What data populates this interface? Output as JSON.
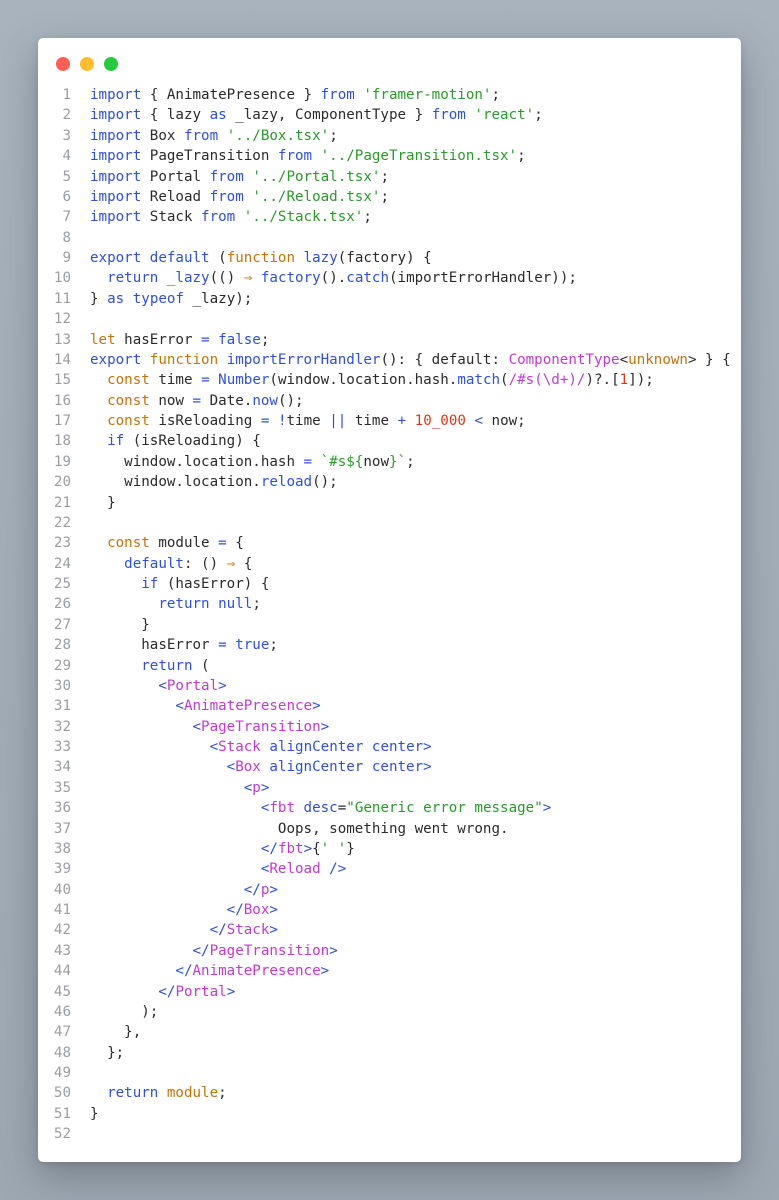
{
  "window": {
    "controls": [
      "close",
      "minimize",
      "maximize"
    ]
  },
  "code": {
    "lines": [
      [
        {
          "t": "import",
          "c": "kw"
        },
        {
          "t": " { AnimatePresence } ",
          "c": ""
        },
        {
          "t": "from",
          "c": "kw"
        },
        {
          "t": " ",
          "c": ""
        },
        {
          "t": "'framer-motion'",
          "c": "str"
        },
        {
          "t": ";",
          "c": ""
        }
      ],
      [
        {
          "t": "import",
          "c": "kw"
        },
        {
          "t": " { lazy ",
          "c": ""
        },
        {
          "t": "as",
          "c": "kw"
        },
        {
          "t": " _lazy, ComponentType } ",
          "c": ""
        },
        {
          "t": "from",
          "c": "kw"
        },
        {
          "t": " ",
          "c": ""
        },
        {
          "t": "'react'",
          "c": "str"
        },
        {
          "t": ";",
          "c": ""
        }
      ],
      [
        {
          "t": "import",
          "c": "kw"
        },
        {
          "t": " Box ",
          "c": ""
        },
        {
          "t": "from",
          "c": "kw"
        },
        {
          "t": " ",
          "c": ""
        },
        {
          "t": "'../Box.tsx'",
          "c": "str"
        },
        {
          "t": ";",
          "c": ""
        }
      ],
      [
        {
          "t": "import",
          "c": "kw"
        },
        {
          "t": " PageTransition ",
          "c": ""
        },
        {
          "t": "from",
          "c": "kw"
        },
        {
          "t": " ",
          "c": ""
        },
        {
          "t": "'../PageTransition.tsx'",
          "c": "str"
        },
        {
          "t": ";",
          "c": ""
        }
      ],
      [
        {
          "t": "import",
          "c": "kw"
        },
        {
          "t": " Portal ",
          "c": ""
        },
        {
          "t": "from",
          "c": "kw"
        },
        {
          "t": " ",
          "c": ""
        },
        {
          "t": "'../Portal.tsx'",
          "c": "str"
        },
        {
          "t": ";",
          "c": ""
        }
      ],
      [
        {
          "t": "import",
          "c": "kw"
        },
        {
          "t": " Reload ",
          "c": ""
        },
        {
          "t": "from",
          "c": "kw"
        },
        {
          "t": " ",
          "c": ""
        },
        {
          "t": "'../Reload.tsx'",
          "c": "str"
        },
        {
          "t": ";",
          "c": ""
        }
      ],
      [
        {
          "t": "import",
          "c": "kw"
        },
        {
          "t": " Stack ",
          "c": ""
        },
        {
          "t": "from",
          "c": "kw"
        },
        {
          "t": " ",
          "c": ""
        },
        {
          "t": "'../Stack.tsx'",
          "c": "str"
        },
        {
          "t": ";",
          "c": ""
        }
      ],
      [],
      [
        {
          "t": "export",
          "c": "kw"
        },
        {
          "t": " ",
          "c": ""
        },
        {
          "t": "default",
          "c": "kw"
        },
        {
          "t": " (",
          "c": ""
        },
        {
          "t": "function",
          "c": "fn"
        },
        {
          "t": " ",
          "c": ""
        },
        {
          "t": "lazy",
          "c": "kw"
        },
        {
          "t": "(factory) {",
          "c": ""
        }
      ],
      [
        {
          "t": "  ",
          "c": ""
        },
        {
          "t": "return",
          "c": "kw"
        },
        {
          "t": " ",
          "c": ""
        },
        {
          "t": "_lazy",
          "c": "kw"
        },
        {
          "t": "(() ",
          "c": ""
        },
        {
          "t": "⇒",
          "c": "fn"
        },
        {
          "t": " ",
          "c": ""
        },
        {
          "t": "factory",
          "c": "kw"
        },
        {
          "t": "().",
          "c": ""
        },
        {
          "t": "catch",
          "c": "kw"
        },
        {
          "t": "(importErrorHandler));",
          "c": ""
        }
      ],
      [
        {
          "t": "} ",
          "c": ""
        },
        {
          "t": "as",
          "c": "kw"
        },
        {
          "t": " ",
          "c": ""
        },
        {
          "t": "typeof",
          "c": "kw"
        },
        {
          "t": " _lazy);",
          "c": ""
        }
      ],
      [],
      [
        {
          "t": "let",
          "c": "fn"
        },
        {
          "t": " hasError ",
          "c": ""
        },
        {
          "t": "=",
          "c": "op"
        },
        {
          "t": " ",
          "c": ""
        },
        {
          "t": "false",
          "c": "kw"
        },
        {
          "t": ";",
          "c": ""
        }
      ],
      [
        {
          "t": "export",
          "c": "kw"
        },
        {
          "t": " ",
          "c": ""
        },
        {
          "t": "function",
          "c": "fn"
        },
        {
          "t": " ",
          "c": ""
        },
        {
          "t": "importErrorHandler",
          "c": "kw"
        },
        {
          "t": "(): { default: ",
          "c": ""
        },
        {
          "t": "ComponentType",
          "c": "ty"
        },
        {
          "t": "<",
          "c": ""
        },
        {
          "t": "unknown",
          "c": "fn"
        },
        {
          "t": "> } {",
          "c": ""
        }
      ],
      [
        {
          "t": "  ",
          "c": ""
        },
        {
          "t": "const",
          "c": "fn"
        },
        {
          "t": " time ",
          "c": ""
        },
        {
          "t": "=",
          "c": "op"
        },
        {
          "t": " ",
          "c": ""
        },
        {
          "t": "Number",
          "c": "kw"
        },
        {
          "t": "(window.location.hash.",
          "c": ""
        },
        {
          "t": "match",
          "c": "kw"
        },
        {
          "t": "(",
          "c": ""
        },
        {
          "t": "/#s(\\d+)/",
          "c": "tag"
        },
        {
          "t": ")?.[",
          "c": ""
        },
        {
          "t": "1",
          "c": "num"
        },
        {
          "t": "]);",
          "c": ""
        }
      ],
      [
        {
          "t": "  ",
          "c": ""
        },
        {
          "t": "const",
          "c": "fn"
        },
        {
          "t": " now ",
          "c": ""
        },
        {
          "t": "=",
          "c": "op"
        },
        {
          "t": " Date.",
          "c": ""
        },
        {
          "t": "now",
          "c": "kw"
        },
        {
          "t": "();",
          "c": ""
        }
      ],
      [
        {
          "t": "  ",
          "c": ""
        },
        {
          "t": "const",
          "c": "fn"
        },
        {
          "t": " isReloading ",
          "c": ""
        },
        {
          "t": "=",
          "c": "op"
        },
        {
          "t": " ",
          "c": ""
        },
        {
          "t": "!",
          "c": "op"
        },
        {
          "t": "time ",
          "c": ""
        },
        {
          "t": "||",
          "c": "op"
        },
        {
          "t": " time ",
          "c": ""
        },
        {
          "t": "+",
          "c": "op"
        },
        {
          "t": " ",
          "c": ""
        },
        {
          "t": "10_000",
          "c": "num"
        },
        {
          "t": " ",
          "c": ""
        },
        {
          "t": "<",
          "c": "op"
        },
        {
          "t": " now;",
          "c": ""
        }
      ],
      [
        {
          "t": "  ",
          "c": ""
        },
        {
          "t": "if",
          "c": "kw"
        },
        {
          "t": " (isReloading) {",
          "c": ""
        }
      ],
      [
        {
          "t": "    window.location.hash ",
          "c": ""
        },
        {
          "t": "=",
          "c": "op"
        },
        {
          "t": " ",
          "c": ""
        },
        {
          "t": "`#s${",
          "c": "str"
        },
        {
          "t": "now",
          "c": ""
        },
        {
          "t": "}`",
          "c": "str"
        },
        {
          "t": ";",
          "c": ""
        }
      ],
      [
        {
          "t": "    window.location.",
          "c": ""
        },
        {
          "t": "reload",
          "c": "kw"
        },
        {
          "t": "();",
          "c": ""
        }
      ],
      [
        {
          "t": "  }",
          "c": ""
        }
      ],
      [],
      [
        {
          "t": "  ",
          "c": ""
        },
        {
          "t": "const",
          "c": "fn"
        },
        {
          "t": " module ",
          "c": ""
        },
        {
          "t": "=",
          "c": "op"
        },
        {
          "t": " {",
          "c": ""
        }
      ],
      [
        {
          "t": "    ",
          "c": ""
        },
        {
          "t": "default",
          "c": "kw"
        },
        {
          "t": ": () ",
          "c": ""
        },
        {
          "t": "⇒",
          "c": "fn"
        },
        {
          "t": " {",
          "c": ""
        }
      ],
      [
        {
          "t": "      ",
          "c": ""
        },
        {
          "t": "if",
          "c": "kw"
        },
        {
          "t": " (hasError) {",
          "c": ""
        }
      ],
      [
        {
          "t": "        ",
          "c": ""
        },
        {
          "t": "return",
          "c": "kw"
        },
        {
          "t": " ",
          "c": ""
        },
        {
          "t": "null",
          "c": "kw"
        },
        {
          "t": ";",
          "c": ""
        }
      ],
      [
        {
          "t": "      }",
          "c": ""
        }
      ],
      [
        {
          "t": "      hasError ",
          "c": ""
        },
        {
          "t": "=",
          "c": "op"
        },
        {
          "t": " ",
          "c": ""
        },
        {
          "t": "true",
          "c": "kw"
        },
        {
          "t": ";",
          "c": ""
        }
      ],
      [
        {
          "t": "      ",
          "c": ""
        },
        {
          "t": "return",
          "c": "kw"
        },
        {
          "t": " (",
          "c": ""
        }
      ],
      [
        {
          "t": "        ",
          "c": ""
        },
        {
          "t": "<",
          "c": "attr"
        },
        {
          "t": "Portal",
          "c": "tag"
        },
        {
          "t": ">",
          "c": "attr"
        }
      ],
      [
        {
          "t": "          ",
          "c": ""
        },
        {
          "t": "<",
          "c": "attr"
        },
        {
          "t": "AnimatePresence",
          "c": "tag"
        },
        {
          "t": ">",
          "c": "attr"
        }
      ],
      [
        {
          "t": "            ",
          "c": ""
        },
        {
          "t": "<",
          "c": "attr"
        },
        {
          "t": "PageTransition",
          "c": "tag"
        },
        {
          "t": ">",
          "c": "attr"
        }
      ],
      [
        {
          "t": "              ",
          "c": ""
        },
        {
          "t": "<",
          "c": "attr"
        },
        {
          "t": "Stack",
          "c": "tag"
        },
        {
          "t": " alignCenter center",
          "c": "attr"
        },
        {
          "t": ">",
          "c": "attr"
        }
      ],
      [
        {
          "t": "                ",
          "c": ""
        },
        {
          "t": "<",
          "c": "attr"
        },
        {
          "t": "Box",
          "c": "tag"
        },
        {
          "t": " alignCenter center",
          "c": "attr"
        },
        {
          "t": ">",
          "c": "attr"
        }
      ],
      [
        {
          "t": "                  ",
          "c": ""
        },
        {
          "t": "<",
          "c": "attr"
        },
        {
          "t": "p",
          "c": "tag"
        },
        {
          "t": ">",
          "c": "attr"
        }
      ],
      [
        {
          "t": "                    ",
          "c": ""
        },
        {
          "t": "<",
          "c": "attr"
        },
        {
          "t": "fbt",
          "c": "tag"
        },
        {
          "t": " desc",
          "c": "attr"
        },
        {
          "t": "=",
          "c": ""
        },
        {
          "t": "\"Generic error message\"",
          "c": "str"
        },
        {
          "t": ">",
          "c": "attr"
        }
      ],
      [
        {
          "t": "                      Oops, something went wrong.",
          "c": ""
        }
      ],
      [
        {
          "t": "                    ",
          "c": ""
        },
        {
          "t": "</",
          "c": "attr"
        },
        {
          "t": "fbt",
          "c": "tag"
        },
        {
          "t": ">",
          "c": "attr"
        },
        {
          "t": "{",
          "c": ""
        },
        {
          "t": "' '",
          "c": "str"
        },
        {
          "t": "}",
          "c": ""
        }
      ],
      [
        {
          "t": "                    ",
          "c": ""
        },
        {
          "t": "<",
          "c": "attr"
        },
        {
          "t": "Reload",
          "c": "tag"
        },
        {
          "t": " />",
          "c": "attr"
        }
      ],
      [
        {
          "t": "                  ",
          "c": ""
        },
        {
          "t": "</",
          "c": "attr"
        },
        {
          "t": "p",
          "c": "tag"
        },
        {
          "t": ">",
          "c": "attr"
        }
      ],
      [
        {
          "t": "                ",
          "c": ""
        },
        {
          "t": "</",
          "c": "attr"
        },
        {
          "t": "Box",
          "c": "tag"
        },
        {
          "t": ">",
          "c": "attr"
        }
      ],
      [
        {
          "t": "              ",
          "c": ""
        },
        {
          "t": "</",
          "c": "attr"
        },
        {
          "t": "Stack",
          "c": "tag"
        },
        {
          "t": ">",
          "c": "attr"
        }
      ],
      [
        {
          "t": "            ",
          "c": ""
        },
        {
          "t": "</",
          "c": "attr"
        },
        {
          "t": "PageTransition",
          "c": "tag"
        },
        {
          "t": ">",
          "c": "attr"
        }
      ],
      [
        {
          "t": "          ",
          "c": ""
        },
        {
          "t": "</",
          "c": "attr"
        },
        {
          "t": "AnimatePresence",
          "c": "tag"
        },
        {
          "t": ">",
          "c": "attr"
        }
      ],
      [
        {
          "t": "        ",
          "c": ""
        },
        {
          "t": "</",
          "c": "attr"
        },
        {
          "t": "Portal",
          "c": "tag"
        },
        {
          "t": ">",
          "c": "attr"
        }
      ],
      [
        {
          "t": "      );",
          "c": ""
        }
      ],
      [
        {
          "t": "    },",
          "c": ""
        }
      ],
      [
        {
          "t": "  };",
          "c": ""
        }
      ],
      [],
      [
        {
          "t": "  ",
          "c": ""
        },
        {
          "t": "return",
          "c": "kw"
        },
        {
          "t": " ",
          "c": ""
        },
        {
          "t": "module",
          "c": "fn"
        },
        {
          "t": ";",
          "c": ""
        }
      ],
      [
        {
          "t": "}",
          "c": ""
        }
      ],
      []
    ]
  },
  "colors": {
    "keyword": "#2f50d8",
    "declaration": "#c4730c",
    "string": "#2a9a2a",
    "jsx_tag": "#c03ad0",
    "number": "#d63a1c",
    "line_number": "#9a9ea3",
    "background": "#ffffff"
  }
}
